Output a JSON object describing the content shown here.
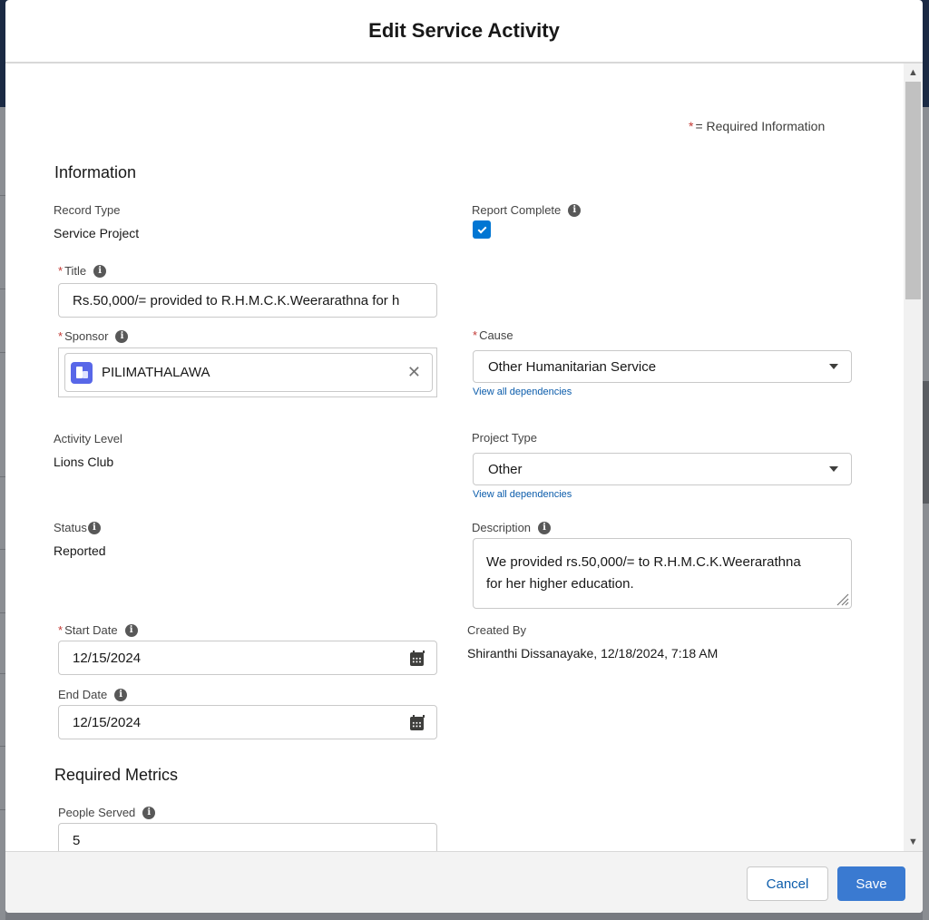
{
  "modal": {
    "title": "Edit Service Activity"
  },
  "required_info": {
    "star": "*",
    "text": "= Required Information"
  },
  "sections": {
    "information": "Information",
    "required_metrics": "Required Metrics"
  },
  "fields": {
    "record_type": {
      "label": "Record Type",
      "value": "Service Project"
    },
    "report_complete": {
      "label": "Report Complete",
      "checked": true
    },
    "title": {
      "label": "Title",
      "value": "Rs.50,000/= provided to R.H.M.C.K.Weerarathna for h"
    },
    "sponsor": {
      "label": "Sponsor",
      "value": "PILIMATHALAWA"
    },
    "cause": {
      "label": "Cause",
      "value": "Other Humanitarian Service",
      "dependencies_link": "View all dependencies"
    },
    "activity_level": {
      "label": "Activity Level",
      "value": "Lions Club"
    },
    "project_type": {
      "label": "Project Type",
      "value": "Other",
      "dependencies_link": "View all dependencies"
    },
    "status": {
      "label": "Status",
      "value": "Reported"
    },
    "description": {
      "label": "Description",
      "line1": "We provided rs.50,000/= to R.H.M.C.K.Weerarathna",
      "line2": "for her higher education."
    },
    "start_date": {
      "label": "Start Date",
      "value": "12/15/2024"
    },
    "created_by": {
      "label": "Created By",
      "value": "Shiranthi Dissanayake, 12/18/2024, 7:18 AM"
    },
    "end_date": {
      "label": "End Date",
      "value": "12/15/2024"
    },
    "people_served": {
      "label": "People Served",
      "value": "5"
    }
  },
  "footer": {
    "cancel_label": "Cancel",
    "save_label": "Save"
  },
  "icons": {
    "info": "info-icon",
    "required": "required-star-icon",
    "account": "account-icon",
    "clear": "close-icon",
    "dropdown": "chevron-down-icon",
    "calendar": "calendar-icon",
    "checkbox": "checkmark-icon"
  },
  "colors": {
    "brand_blue": "#0176d3",
    "save_button": "#3a7ad1",
    "link": "#0b5cab",
    "required": "#c23934",
    "account_icon": "#5867e8"
  }
}
